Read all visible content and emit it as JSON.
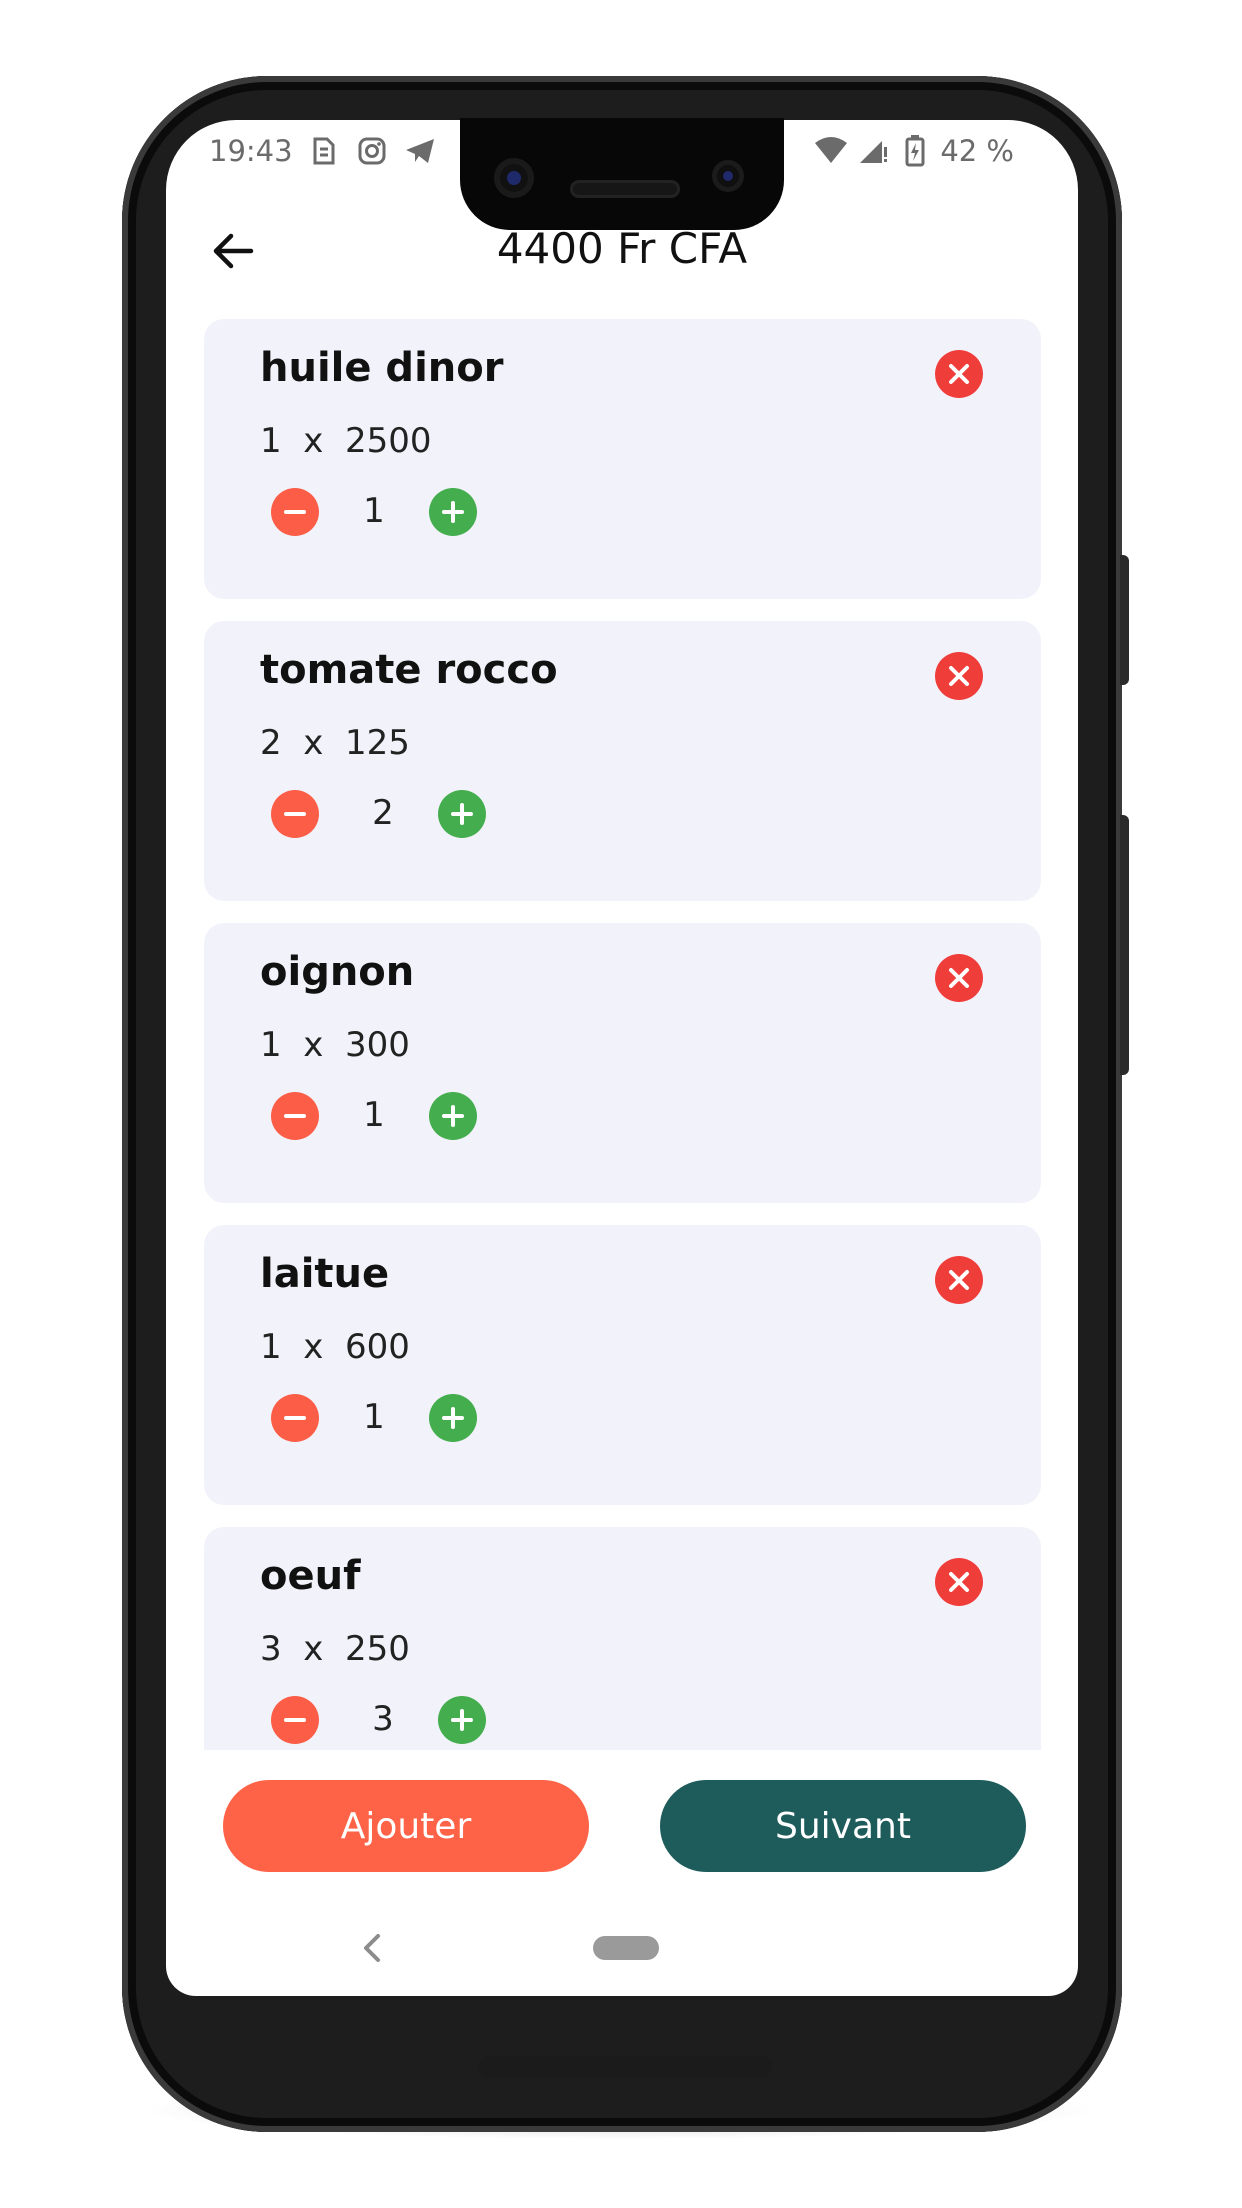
{
  "status_bar": {
    "time": "19:43",
    "battery": "42 %",
    "left_icons": [
      "sim-icon",
      "instagram-icon",
      "telegram-icon"
    ],
    "right_icons": [
      "wifi-icon",
      "cell-signal-icon",
      "battery-charging-icon"
    ]
  },
  "header": {
    "title": "4400 Fr CFA",
    "back_icon": "arrow-left-icon"
  },
  "cart_items": [
    {
      "name": "huile dinor",
      "price_line": "1  x  2500",
      "quantity": "1"
    },
    {
      "name": "tomate rocco",
      "price_line": "2  x  125",
      "quantity": "2"
    },
    {
      "name": "oignon",
      "price_line": "1  x  300",
      "quantity": "1"
    },
    {
      "name": "laitue",
      "price_line": "1  x  600",
      "quantity": "1"
    },
    {
      "name": "oeuf",
      "price_line": "3  x  250",
      "quantity": "3"
    }
  ],
  "actions": {
    "add_label": "Ajouter",
    "next_label": "Suivant"
  },
  "colors": {
    "remove": "#ef3d3a",
    "minus": "#fc5d46",
    "plus": "#44ad4d",
    "add_button": "#fe6247",
    "next_button": "#1e5b5b",
    "card_bg": "#f2f3fa"
  },
  "nav_bar": {
    "back_icon": "nav-back-icon",
    "home_icon": "home-pill-icon"
  }
}
